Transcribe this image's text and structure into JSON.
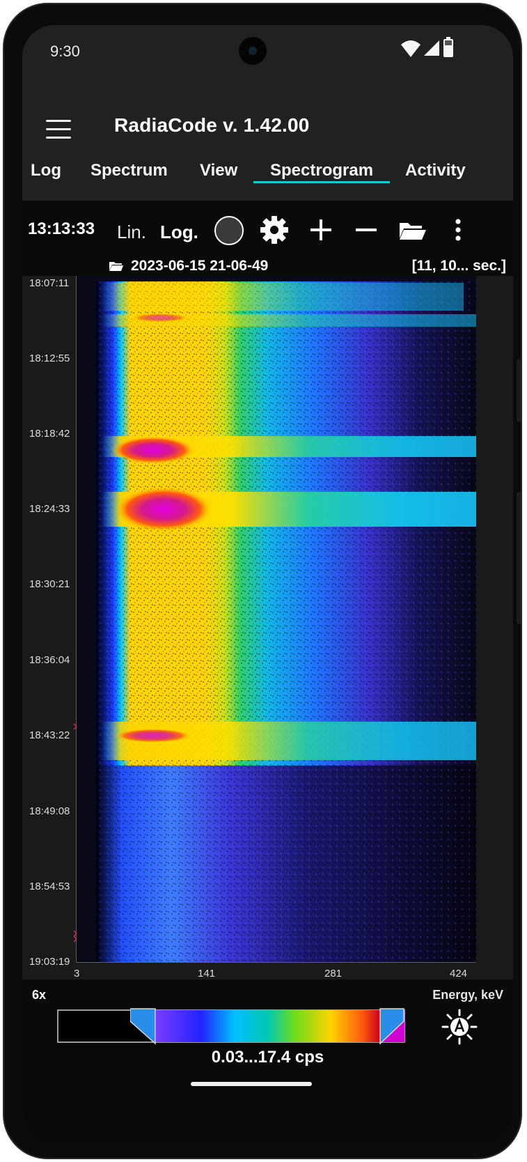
{
  "status": {
    "time": "9:30"
  },
  "app": {
    "title": "RadiaCode v. 1.42.00"
  },
  "tabs": [
    {
      "label": "Log"
    },
    {
      "label": "Spectrum"
    },
    {
      "label": "View"
    },
    {
      "label": "Spectrogram",
      "active": true
    },
    {
      "label": "Activity"
    }
  ],
  "toolbar": {
    "time": "13:13:33",
    "lin_label": "Lin.",
    "log_label": "Log.",
    "icons": [
      "record-circle-icon",
      "settings-gear-icon",
      "zoom-in-plus-icon",
      "zoom-out-minus-icon",
      "open-folder-icon",
      "more-vert-icon"
    ]
  },
  "file": {
    "name": "2023-06-15 21-06-49",
    "range": "[11, 10... sec.]"
  },
  "axes": {
    "y_ticks": [
      "18:07:11",
      "18:12:55",
      "18:18:42",
      "18:24:33",
      "18:30:21",
      "18:36:04",
      "18:43:22",
      "18:49:08",
      "18:54:53",
      "19:03:19"
    ],
    "x_ticks": [
      "3",
      "141",
      "281",
      "424"
    ],
    "x_label": "Energy, keV"
  },
  "legend": {
    "zoom": "6x",
    "range": "0.03...17.4 cps"
  },
  "colors": {
    "background": "#212121",
    "accent_tab": "#1cc7cf",
    "marker": "#e0246a"
  }
}
